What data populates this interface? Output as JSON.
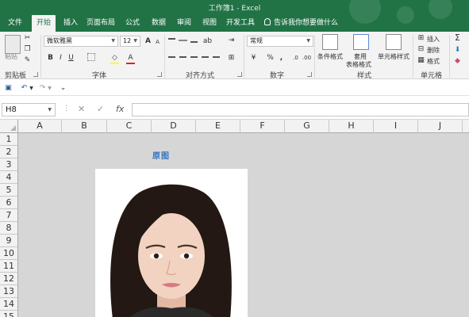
{
  "window": {
    "title": "工作簿1 - Excel"
  },
  "tabs": [
    "文件",
    "开始",
    "插入",
    "页面布局",
    "公式",
    "数据",
    "审阅",
    "视图",
    "开发工具"
  ],
  "tell_me": "告诉我你想要做什么",
  "ribbon": {
    "clipboard": {
      "paste": "粘贴",
      "label": "剪贴板"
    },
    "font": {
      "name": "微软雅黑",
      "size": "12",
      "bold": "B",
      "italic": "I",
      "underline": "U",
      "label": "字体",
      "grow": "A",
      "shrink": "A",
      "color": "A"
    },
    "alignment": {
      "label": "对齐方式"
    },
    "number": {
      "format": "常规",
      "percent": "%",
      "comma": ",",
      "label": "数字"
    },
    "styles": {
      "conditional": "条件格式",
      "table_line1": "套用",
      "table_line2": "表格格式",
      "cell_styles": "单元格样式",
      "label": "样式"
    },
    "cells": {
      "insert": "插入",
      "delete": "删除",
      "format": "格式",
      "label": "单元格"
    }
  },
  "formula_bar": {
    "name_box": "H8",
    "fx": "fx",
    "cancel": "✕",
    "enter": "✓",
    "value": ""
  },
  "sheet": {
    "columns": [
      "A",
      "B",
      "C",
      "D",
      "E",
      "F",
      "G",
      "H",
      "I",
      "J"
    ],
    "rows": [
      "1",
      "2",
      "3",
      "4",
      "5",
      "6",
      "7",
      "8",
      "9",
      "10",
      "11",
      "12",
      "13",
      "14",
      "15"
    ],
    "caption": "原图"
  },
  "colors": {
    "brand": "#217346",
    "caption": "#2e74c5",
    "grid_bg": "#d6d6d6"
  },
  "icons": [
    "cut-icon",
    "copy-icon",
    "format-painter-icon",
    "save-icon",
    "undo-icon",
    "redo-icon",
    "lightbulb-icon",
    "sum-icon",
    "fill-icon",
    "clear-icon"
  ]
}
